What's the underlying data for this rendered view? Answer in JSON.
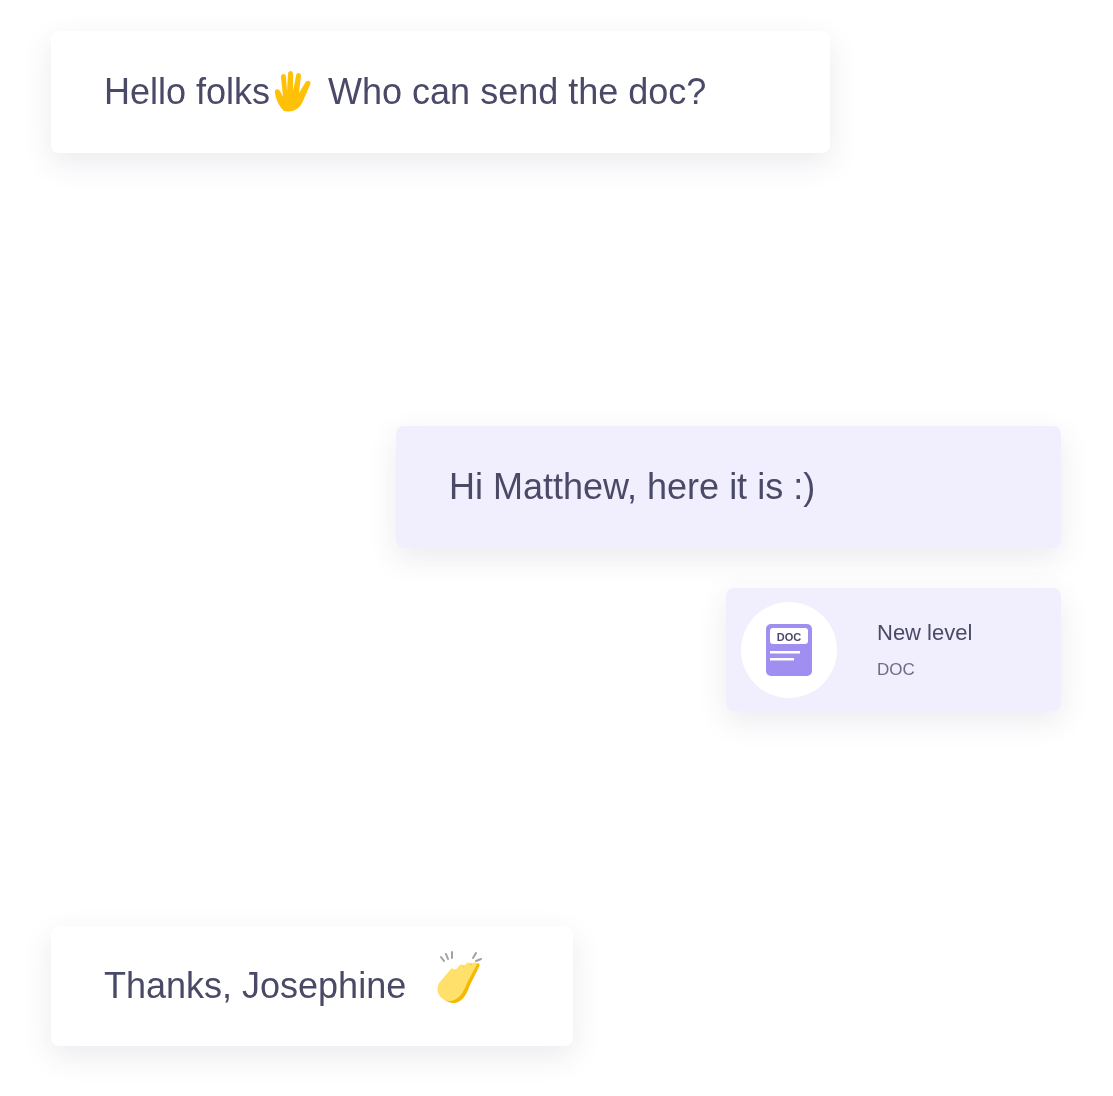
{
  "messages": [
    {
      "kind": "text",
      "outgoing": false,
      "segments": [
        "Hello folks",
        "Who can send the doc?"
      ]
    },
    {
      "kind": "text",
      "outgoing": true,
      "segments": [
        "Hi Matthew, here it is :)"
      ]
    },
    {
      "kind": "file",
      "outgoing": true,
      "badge": "DOC",
      "title": "New level",
      "file_type": "DOC"
    },
    {
      "kind": "text",
      "outgoing": false,
      "segments": [
        "Thanks, Josephine"
      ]
    }
  ]
}
